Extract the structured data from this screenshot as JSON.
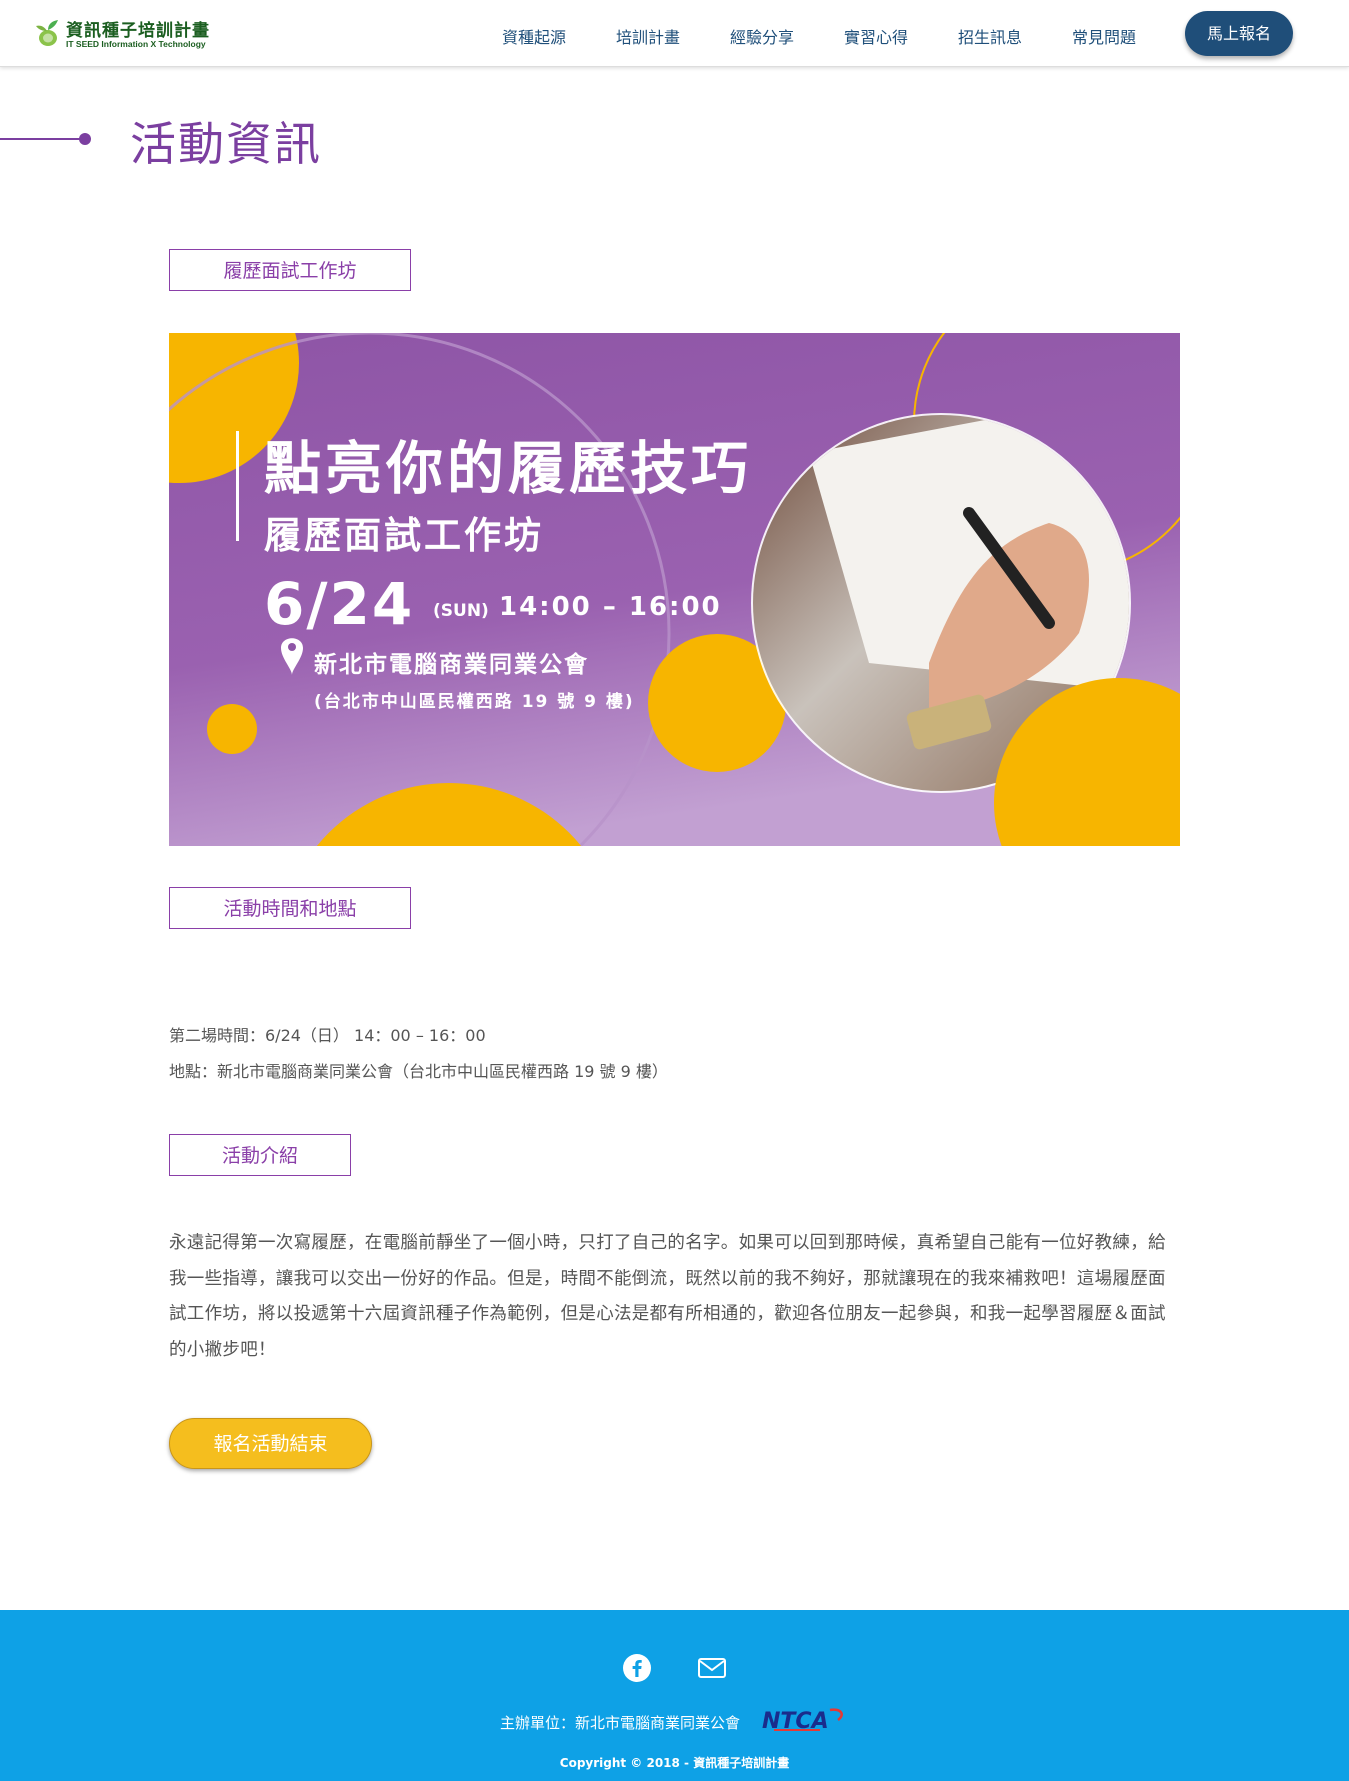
{
  "header": {
    "logo_title": "資訊種子培訓計畫",
    "logo_subtitle": "IT SEED  Information X Technology",
    "nav": [
      "資種起源",
      "培訓計畫",
      "經驗分享",
      "實習心得",
      "招生訊息",
      "常見問題"
    ],
    "signup_label": "馬上報名"
  },
  "page_title": "活動資訊",
  "sections": {
    "workshop_tag": "履歷面試工作坊",
    "time_place_tag": "活動時間和地點",
    "intro_tag": "活動介紹"
  },
  "banner": {
    "headline": "點亮你的履歷技巧",
    "subheadline": "履歷面試工作坊",
    "date": "6/24",
    "weekday": "(SUN)",
    "time": "14:00 – 16:00",
    "venue": "新北市電腦商業同業公會",
    "address": "(台北市中山區民權西路 19 號 9 樓)",
    "colors": {
      "purple": "#8e55a6",
      "yellow": "#f7b500"
    }
  },
  "time_place": {
    "time_line": "第二場時間：6/24（日） 14：00 – 16：00",
    "place_line": "地點：新北市電腦商業同業公會（台北市中山區民權西路 19 號 9 樓）"
  },
  "intro_text": "永遠記得第一次寫履歷，在電腦前靜坐了一個小時，只打了自己的名字。如果可以回到那時候，真希望自己能有一位好教練，給我一些指導，讓我可以交出一份好的作品。但是，時間不能倒流，既然以前的我不夠好，那就讓現在的我來補救吧！這場履歷面試工作坊，將以投遞第十六屆資訊種子作為範例，但是心法是都有所相通的，歡迎各位朋友一起參與，和我一起學習履歷＆面試的小撇步吧！",
  "end_button": "報名活動結束",
  "footer": {
    "organizer": "主辦單位：新北市電腦商業同業公會",
    "ntca": "NTCA",
    "copyright": "Copyright © 2018 - 資訊種子培訓計畫",
    "icons": [
      "facebook-icon",
      "mail-icon"
    ]
  }
}
